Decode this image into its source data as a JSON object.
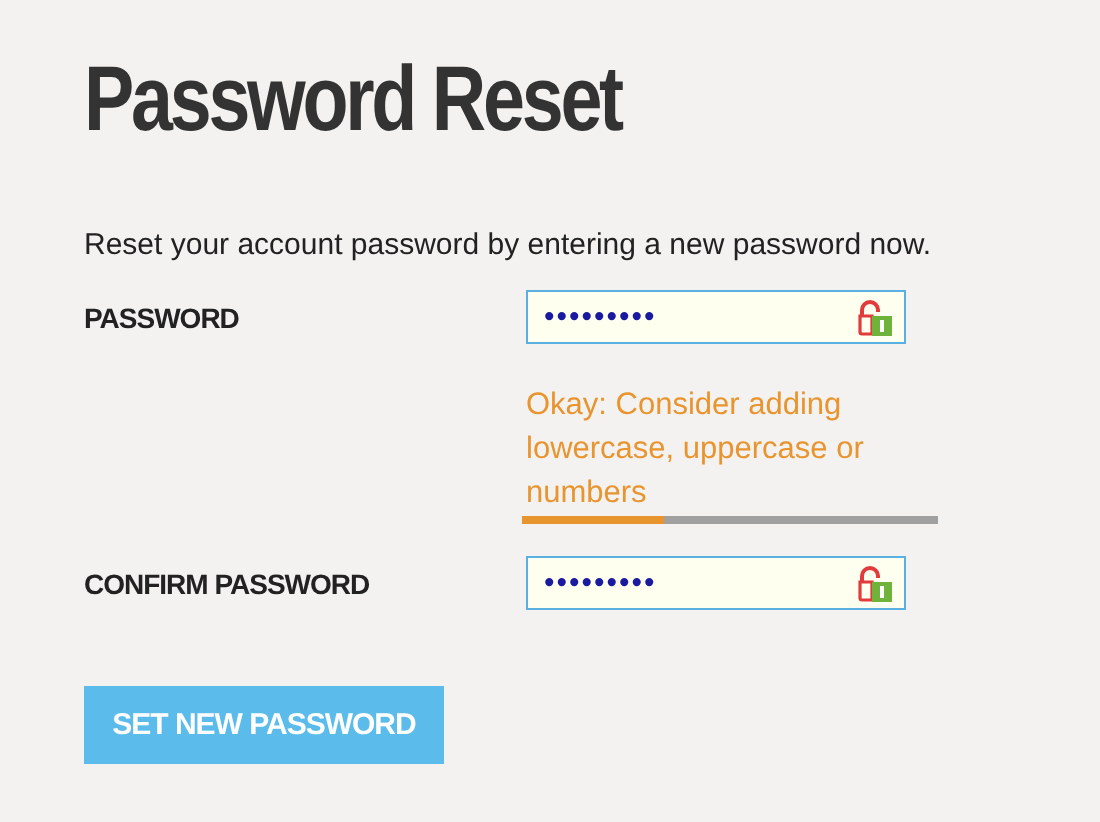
{
  "title": "Password Reset",
  "description": "Reset your account password by entering a new password now.",
  "fields": [
    {
      "label": "PASSWORD",
      "value": "•••••••••",
      "feedback": "Okay: Consider adding lowercase, uppercase or numbers",
      "strength": {
        "level": 0.34
      }
    },
    {
      "label": "CONFIRM PASSWORD",
      "value": "•••••••••"
    }
  ],
  "button": "SET NEW PASSWORD"
}
